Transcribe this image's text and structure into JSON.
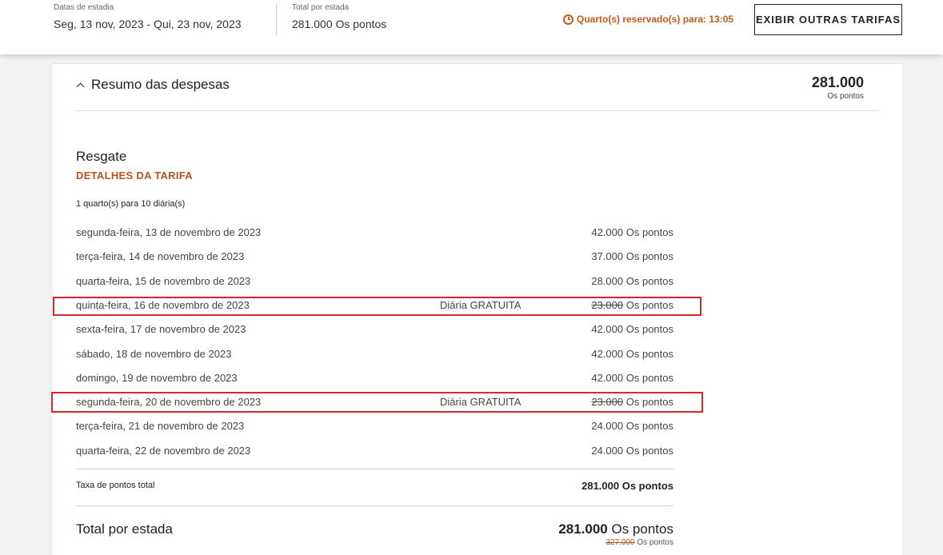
{
  "header": {
    "dates_label": "Datas de estadia",
    "dates_value": "Seg, 13 nov, 2023 - Qui, 23 nov, 2023",
    "total_label": "Total por estada",
    "total_value": "281.000 Os pontos",
    "hold_text": "Quarto(s) reservado(s) para: 13:05",
    "other_rates_button": "EXIBIR OUTRAS TARIFAS"
  },
  "summary": {
    "title": "Resumo das despesas",
    "total_points": "281.000",
    "total_unit": "Os pontos"
  },
  "redemption": {
    "title": "Resgate",
    "rate_details_link": "DETALHES DA TARIFA",
    "rooms_nights": "1 quarto(s) para 10 diária(s)",
    "nights": [
      {
        "date": "segunda-feira, 13 de novembro de 2023",
        "free": "",
        "points": "42.000",
        "unit": "Os pontos"
      },
      {
        "date": "terça-feira, 14 de novembro de 2023",
        "free": "",
        "points": "37.000",
        "unit": "Os pontos"
      },
      {
        "date": "quarta-feira, 15 de novembro de 2023",
        "free": "",
        "points": "28.000",
        "unit": "Os pontos"
      },
      {
        "date": "quinta-feira, 16 de novembro de 2023",
        "free": "Diária GRATUITA",
        "points": "23.000",
        "unit": "Os pontos"
      },
      {
        "date": "sexta-feira, 17 de novembro de 2023",
        "free": "",
        "points": "42.000",
        "unit": "Os pontos"
      },
      {
        "date": "sábado, 18 de novembro de 2023",
        "free": "",
        "points": "42.000",
        "unit": "Os pontos"
      },
      {
        "date": "domingo, 19 de novembro de 2023",
        "free": "",
        "points": "42.000",
        "unit": "Os pontos"
      },
      {
        "date": "segunda-feira, 20 de novembro de 2023",
        "free": "Diária GRATUITA",
        "points": "23.000",
        "unit": "Os pontos"
      },
      {
        "date": "terça-feira, 21 de novembro de 2023",
        "free": "",
        "points": "24.000",
        "unit": "Os pontos"
      },
      {
        "date": "quarta-feira, 22 de novembro de 2023",
        "free": "",
        "points": "24.000",
        "unit": "Os pontos"
      }
    ],
    "fee_label": "Taxa de pontos total",
    "fee_value": "281.000 Os pontos",
    "total_label": "Total por estada",
    "total_points": "281.000",
    "total_unit": "Os pontos",
    "original_points": "327.000",
    "original_unit": "Os pontos"
  },
  "colors": {
    "accent": "#b5531e",
    "highlight": "#d7262c"
  }
}
